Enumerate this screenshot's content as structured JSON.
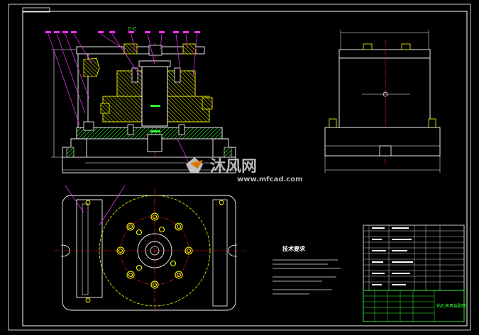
{
  "section_label": "C-C",
  "technical_requirements_title": "技术要求",
  "title_block": {
    "drawing_name": "钻孔夹具装配图"
  },
  "watermark": {
    "brand": "沐风网",
    "url": "www.mfcad.com"
  },
  "colors": {
    "background": "#000000",
    "frame": "#ffffff",
    "leader": "#ff33ff",
    "part_outline": "#ffff00",
    "section_fill": "#33ff33",
    "centerline": "#ff2222",
    "dimension": "#ffffff",
    "title_block_grid": "#33ff33"
  }
}
